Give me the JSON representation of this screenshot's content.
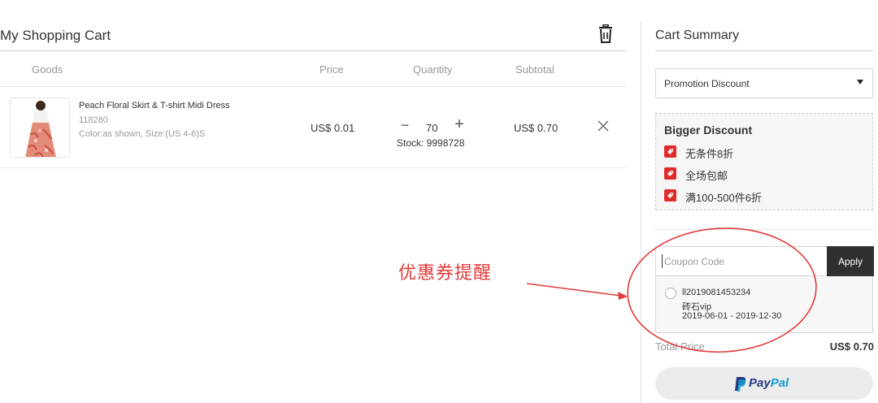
{
  "cart": {
    "title": "My Shopping Cart",
    "columns": {
      "goods": "Goods",
      "price": "Price",
      "quantity": "Quantity",
      "subtotal": "Subtotal"
    },
    "items": [
      {
        "name": "Peach Floral Skirt & T-shirt Midi Dress",
        "sku": "118280",
        "attributes": "Color:as shown, Size:(US 4-6)S",
        "price": "US$ 0.01",
        "quantity": "70",
        "minus_symbol": "−",
        "plus_symbol": "+",
        "stock": "Stock: 9998728",
        "subtotal": "US$ 0.70"
      }
    ]
  },
  "summary": {
    "title": "Cart Summary",
    "promotion_select": "Promotion Discount",
    "promo_box": {
      "heading": "Bigger Discount",
      "items": [
        "无条件8折",
        "全场包邮",
        "满100-500件6折"
      ]
    },
    "coupon": {
      "placeholder": "Coupon Code",
      "apply_label": "Apply",
      "options": [
        {
          "code": "ll2019081453234",
          "name": "砖石vip",
          "dates": "2019-06-01 - 2019-12-30"
        }
      ]
    },
    "total_label": "Total Price",
    "total_value": "US$ 0.70",
    "paypal": {
      "pay": "Pay",
      "pal": "Pal"
    }
  },
  "annotation": {
    "text": "优惠券提醒",
    "color": "#e23b3b"
  },
  "colors": {
    "accent_red": "#e02b2b",
    "apply_button": "#2f2f2f",
    "paypal_dark": "#253b80",
    "paypal_light": "#179bd7"
  }
}
